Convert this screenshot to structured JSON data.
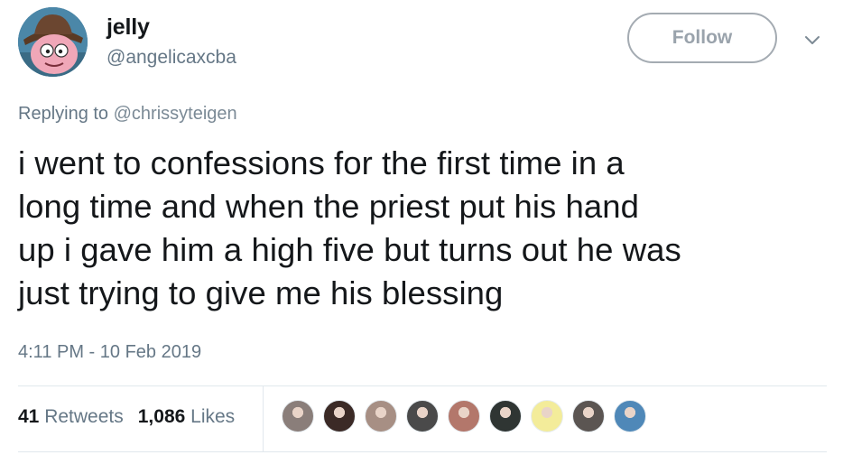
{
  "user": {
    "name": "jelly",
    "handle": "@angelicaxcba"
  },
  "follow": {
    "label": "Follow"
  },
  "reply": {
    "prefix": "Replying to",
    "to": "@chrissyteigen"
  },
  "tweet": {
    "lines": [
      "i went to confessions for the first time in a",
      "long time and when the priest put his hand",
      "up i gave him a high five but turns out he was",
      "just trying to give me his blessing"
    ]
  },
  "timestamp": "4:11 PM - 10 Feb 2019",
  "stats": {
    "retweets_count": "41",
    "retweets_label": "Retweets",
    "likes_count": "1,086",
    "likes_label": "Likes"
  },
  "likers": [
    {
      "name": "liker-1",
      "color": "#8a7e7a"
    },
    {
      "name": "liker-2",
      "color": "#3b2a26"
    },
    {
      "name": "liker-3",
      "color": "#a78f84"
    },
    {
      "name": "liker-4",
      "color": "#4a4a4a"
    },
    {
      "name": "liker-5",
      "color": "#b3776b"
    },
    {
      "name": "liker-6",
      "color": "#2f3533"
    },
    {
      "name": "liker-7",
      "color": "#f3ec9a"
    },
    {
      "name": "liker-8",
      "color": "#5b5552"
    },
    {
      "name": "liker-9",
      "color": "#4f88b8"
    }
  ],
  "colors": {
    "text": "#14171a",
    "secondary": "#657786",
    "border": "#e1e8ed"
  }
}
